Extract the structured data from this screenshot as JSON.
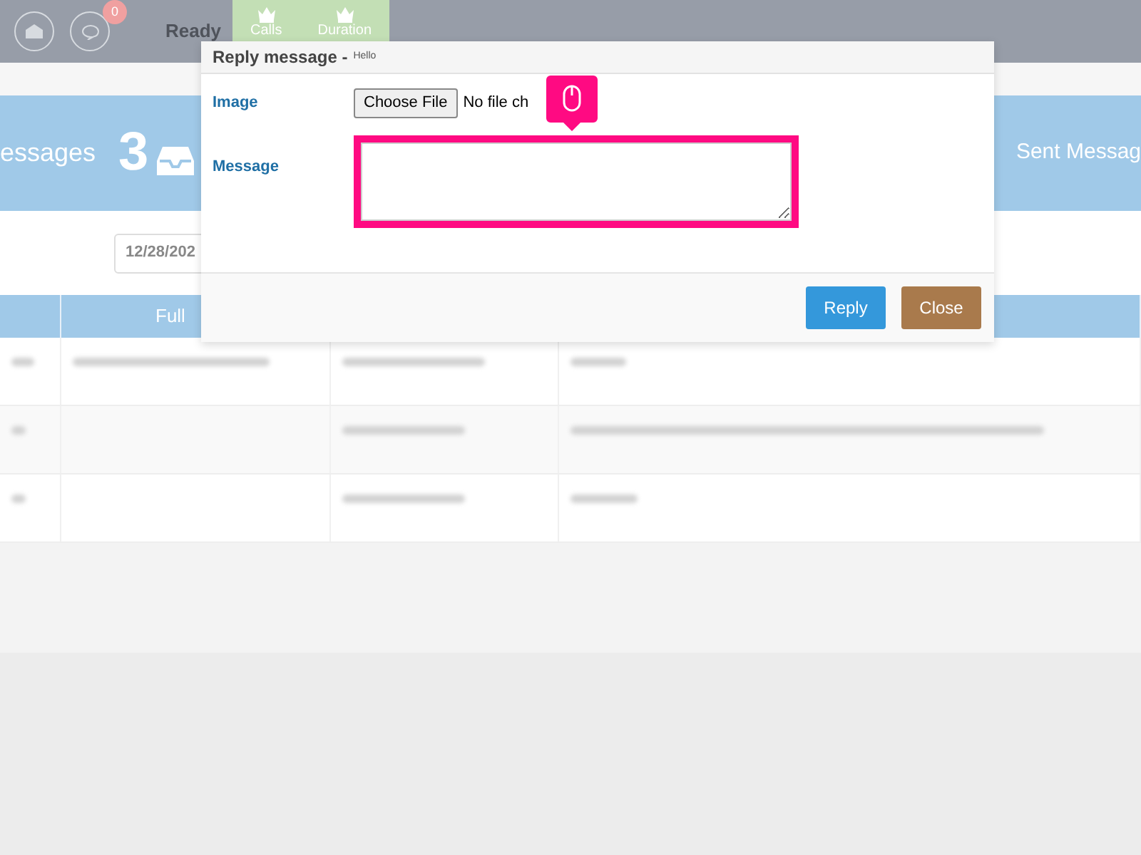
{
  "top_bar": {
    "notification_count": "0",
    "status": "Ready",
    "tabs": [
      {
        "label": "Calls"
      },
      {
        "label": "Duration"
      }
    ]
  },
  "banner": {
    "left_label": "essages",
    "count": "3",
    "right_label": "Sent Messag"
  },
  "filter": {
    "date": "12/28/202"
  },
  "table": {
    "columns": [
      {
        "label": "Full"
      }
    ]
  },
  "modal": {
    "title": "Reply message -",
    "subtitle": "Hello",
    "fields": [
      {
        "label": "Image",
        "kind": "file",
        "button": "Choose File",
        "status": "No file ch"
      },
      {
        "label": "Message",
        "kind": "textarea",
        "highlighted": true
      }
    ],
    "buttons": [
      {
        "label": "Reply",
        "kind": "primary"
      },
      {
        "label": "Close",
        "kind": "secondary"
      }
    ]
  }
}
